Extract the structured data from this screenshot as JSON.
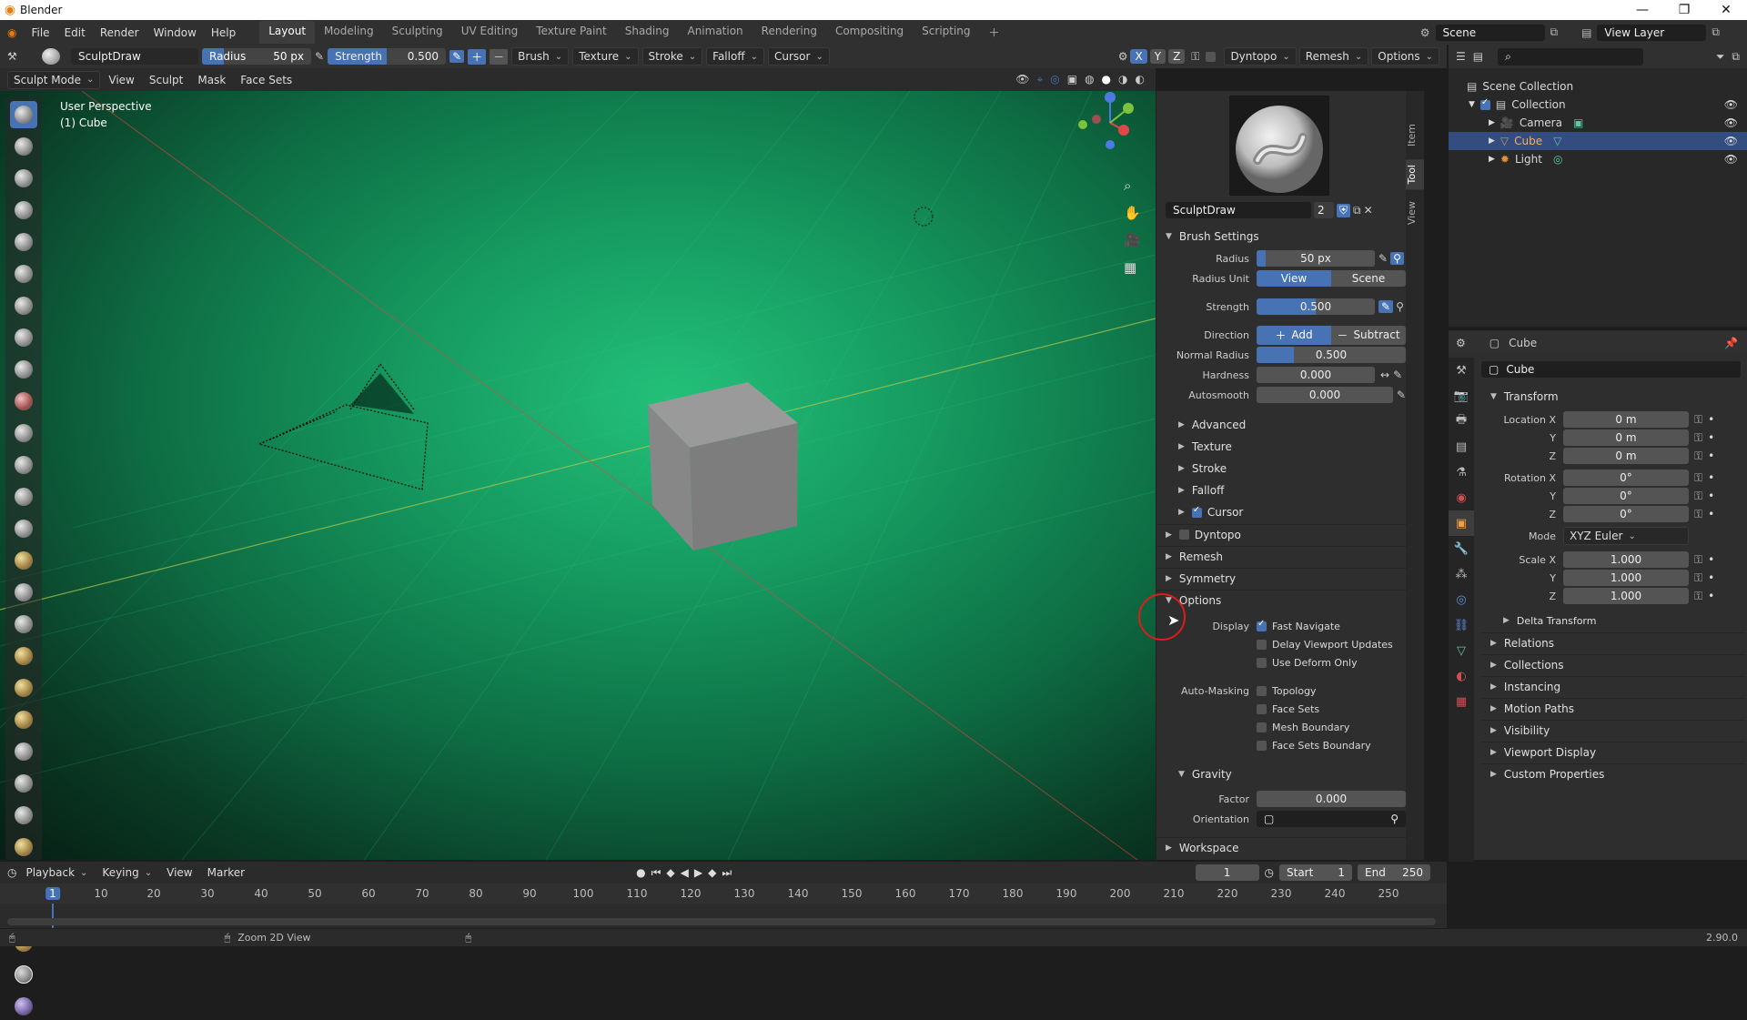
{
  "window": {
    "title": "Blender",
    "minimize": "—",
    "maximize": "❐",
    "close": "✕"
  },
  "menu": [
    "File",
    "Edit",
    "Render",
    "Window",
    "Help"
  ],
  "workspaces": [
    "Layout",
    "Modeling",
    "Sculpting",
    "UV Editing",
    "Texture Paint",
    "Shading",
    "Animation",
    "Rendering",
    "Compositing",
    "Scripting"
  ],
  "scene": {
    "name": "Scene",
    "view_layer": "View Layer"
  },
  "tool_header": {
    "brush_name": "SculptDraw",
    "radius_label": "Radius",
    "radius_value": "50 px",
    "strength_label": "Strength",
    "strength_value": "0.500",
    "menus": [
      "Brush",
      "Texture",
      "Stroke",
      "Falloff",
      "Cursor"
    ],
    "axes": [
      "X",
      "Y",
      "Z"
    ],
    "right_menus": [
      "Dyntopo",
      "Remesh",
      "Options"
    ]
  },
  "viewport_header": {
    "mode": "Sculpt Mode",
    "menus": [
      "View",
      "Sculpt",
      "Mask",
      "Face Sets"
    ]
  },
  "viewport": {
    "perspective": "User Perspective",
    "object": "(1) Cube"
  },
  "npanel": {
    "tabs": [
      "Item",
      "Tool",
      "View"
    ],
    "brush_name": "SculptDraw",
    "users": "2",
    "brush_settings": {
      "title": "Brush Settings",
      "radius_label": "Radius",
      "radius_value": "50 px",
      "radius_unit_label": "Radius Unit",
      "radius_unit_view": "View",
      "radius_unit_scene": "Scene",
      "strength_label": "Strength",
      "strength_value": "0.500",
      "direction_label": "Direction",
      "direction_add": "Add",
      "direction_subtract": "Subtract",
      "normal_radius_label": "Normal Radius",
      "normal_radius_value": "0.500",
      "hardness_label": "Hardness",
      "hardness_value": "0.000",
      "autosmooth_label": "Autosmooth",
      "autosmooth_value": "0.000"
    },
    "subpanels": [
      "Advanced",
      "Texture",
      "Stroke",
      "Falloff",
      "Cursor"
    ],
    "panels": [
      "Dyntopo",
      "Remesh",
      "Symmetry",
      "Options"
    ],
    "options": {
      "display_label": "Display",
      "display_items": [
        {
          "label": "Fast Navigate",
          "checked": true
        },
        {
          "label": "Delay Viewport Updates",
          "checked": false
        },
        {
          "label": "Use Deform Only",
          "checked": false
        }
      ],
      "automask_label": "Auto-Masking",
      "automask_items": [
        {
          "label": "Topology",
          "checked": false
        },
        {
          "label": "Face Sets",
          "checked": false
        },
        {
          "label": "Mesh Boundary",
          "checked": false
        },
        {
          "label": "Face Sets Boundary",
          "checked": false
        }
      ],
      "gravity_title": "Gravity",
      "factor_label": "Factor",
      "factor_value": "0.000",
      "orientation_label": "Orientation"
    },
    "workspace": "Workspace"
  },
  "outliner": {
    "items": [
      {
        "label": "Scene Collection"
      },
      {
        "label": "Collection"
      },
      {
        "label": "Camera"
      },
      {
        "label": "Cube"
      },
      {
        "label": "Light"
      }
    ]
  },
  "properties": {
    "object_name": "Cube",
    "object_field": "Cube",
    "transform_title": "Transform",
    "location_label": "Location X",
    "location": [
      "0 m",
      "0 m",
      "0 m"
    ],
    "rotation_label": "Rotation X",
    "rotation": [
      "0°",
      "0°",
      "0°"
    ],
    "axis_y": "Y",
    "axis_z": "Z",
    "mode_label": "Mode",
    "mode_value": "XYZ Euler",
    "scale_label": "Scale X",
    "scale": [
      "1.000",
      "1.000",
      "1.000"
    ],
    "delta_transform": "Delta Transform",
    "sections": [
      "Relations",
      "Collections",
      "Instancing",
      "Motion Paths",
      "Visibility",
      "Viewport Display",
      "Custom Properties"
    ]
  },
  "timeline": {
    "menus": [
      "Playback",
      "Keying",
      "View",
      "Marker"
    ],
    "current_frame": "1",
    "start_label": "Start",
    "start_value": "1",
    "end_label": "End",
    "end_value": "250",
    "ticks": [
      "1",
      "10",
      "20",
      "30",
      "40",
      "50",
      "60",
      "70",
      "80",
      "90",
      "100",
      "110",
      "120",
      "130",
      "140",
      "150",
      "160",
      "170",
      "180",
      "190",
      "200",
      "210",
      "220",
      "230",
      "240",
      "250"
    ]
  },
  "status": {
    "hint": "Zoom 2D View",
    "version": "2.90.0"
  }
}
